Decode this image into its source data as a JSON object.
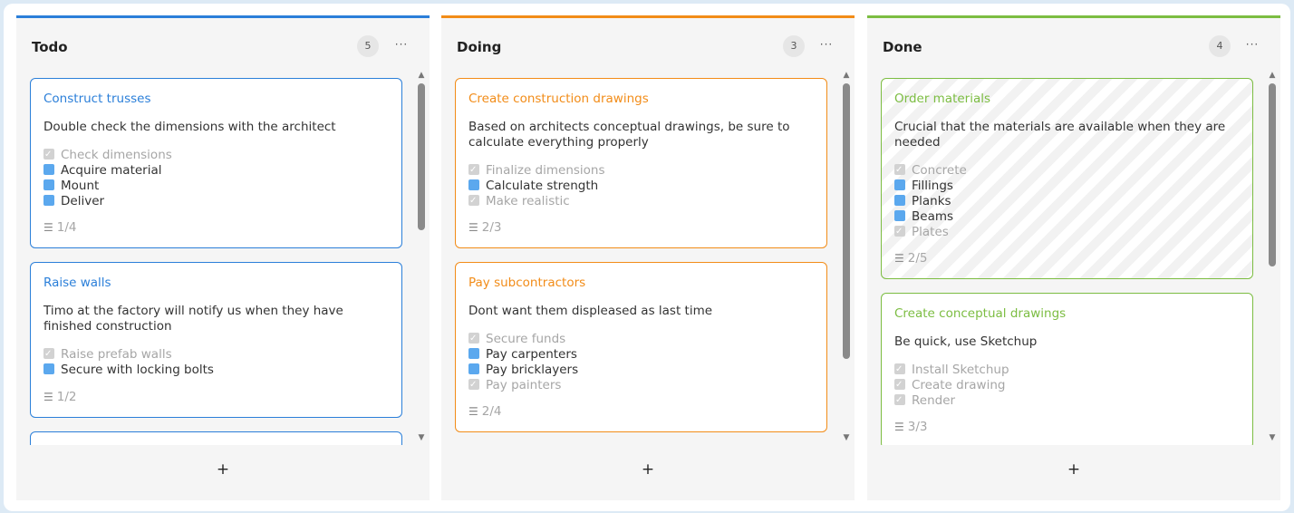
{
  "colors": {
    "todo": "#2b7fd9",
    "doing": "#f28c18",
    "done": "#7cbd42"
  },
  "columns": [
    {
      "title": "Todo",
      "count": "5",
      "menu": "···",
      "add": "+",
      "cards": [
        {
          "title": "Construct trusses",
          "description": "Double check the dimensions with the architect",
          "checklist": [
            {
              "label": "Check dimensions",
              "done": true
            },
            {
              "label": "Acquire material",
              "done": false
            },
            {
              "label": "Mount",
              "done": false
            },
            {
              "label": "Deliver",
              "done": false
            }
          ],
          "progress": "1/4"
        },
        {
          "title": "Raise walls",
          "description": "Timo at the factory will notify us when they have finished construction",
          "checklist": [
            {
              "label": "Raise prefab walls",
              "done": true
            },
            {
              "label": "Secure with locking bolts",
              "done": false
            }
          ],
          "progress": "1/2"
        }
      ]
    },
    {
      "title": "Doing",
      "count": "3",
      "menu": "···",
      "add": "+",
      "cards": [
        {
          "title": "Create construction drawings",
          "description": "Based on architects conceptual drawings, be sure to calculate everything properly",
          "checklist": [
            {
              "label": "Finalize dimensions",
              "done": true
            },
            {
              "label": "Calculate strength",
              "done": false
            },
            {
              "label": "Make realistic",
              "done": true
            }
          ],
          "progress": "2/3"
        },
        {
          "title": "Pay subcontractors",
          "description": "Dont want them displeased as last time",
          "checklist": [
            {
              "label": "Secure funds",
              "done": true
            },
            {
              "label": "Pay carpenters",
              "done": false
            },
            {
              "label": "Pay bricklayers",
              "done": false
            },
            {
              "label": "Pay painters",
              "done": true
            }
          ],
          "progress": "2/4"
        }
      ]
    },
    {
      "title": "Done",
      "count": "4",
      "menu": "···",
      "add": "+",
      "cards": [
        {
          "title": "Order materials",
          "description": "Crucial that the materials are available when they are needed",
          "checklist": [
            {
              "label": "Concrete",
              "done": true
            },
            {
              "label": "Fillings",
              "done": false
            },
            {
              "label": "Planks",
              "done": false
            },
            {
              "label": "Beams",
              "done": false
            },
            {
              "label": "Plates",
              "done": true
            }
          ],
          "progress": "2/5"
        },
        {
          "title": "Create conceptual drawings",
          "description": "Be quick, use Sketchup",
          "checklist": [
            {
              "label": "Install Sketchup",
              "done": true
            },
            {
              "label": "Create drawing",
              "done": true
            },
            {
              "label": "Render",
              "done": true
            }
          ],
          "progress": "3/3"
        }
      ]
    }
  ]
}
